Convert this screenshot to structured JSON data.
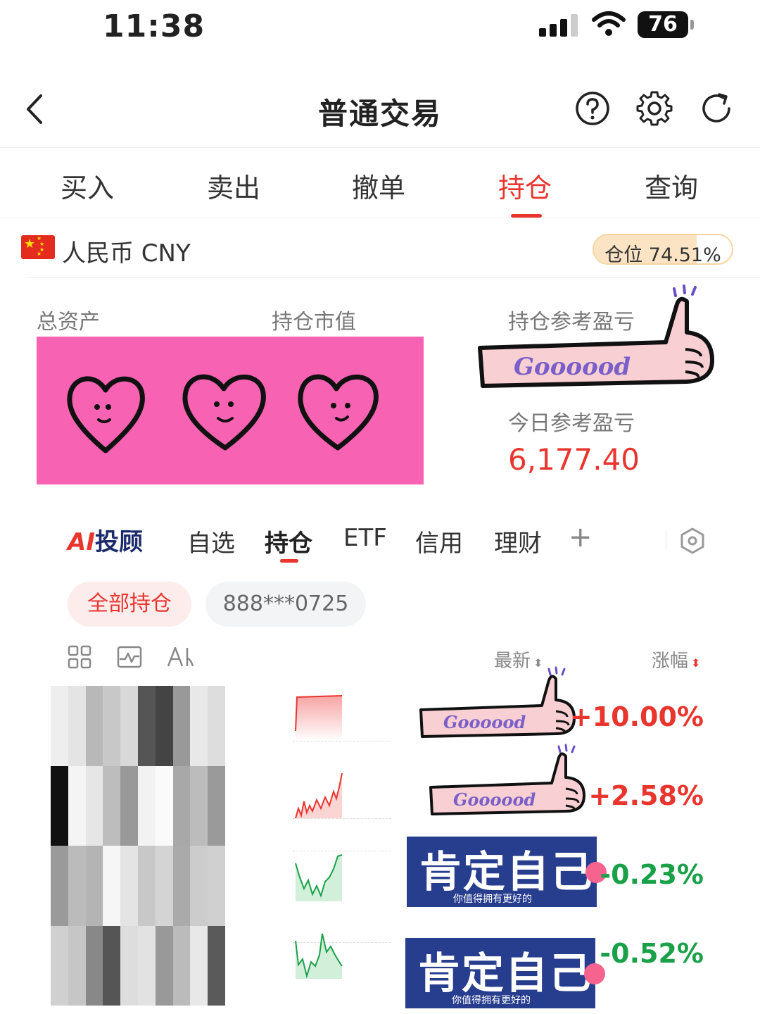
{
  "status": {
    "time": "11:38",
    "battery": "76"
  },
  "header": {
    "title": "普通交易",
    "icons": [
      "back-chevron-icon",
      "help-icon",
      "settings-gear-icon",
      "refresh-icon"
    ]
  },
  "tabs": [
    {
      "label": "买入",
      "active": false
    },
    {
      "label": "卖出",
      "active": false
    },
    {
      "label": "撤单",
      "active": false
    },
    {
      "label": "持仓",
      "active": true
    },
    {
      "label": "查询",
      "active": false
    }
  ],
  "currency": {
    "label": "人民币 CNY",
    "position_label": "仓位 74.51%",
    "position_fraction": 0.7451
  },
  "assets": {
    "total_label": "总资产",
    "market_value_label": "持仓市值",
    "holding_pl_label": "持仓参考盈亏",
    "today_pl_label": "今日参考盈亏",
    "today_pl_value": "6,177.40"
  },
  "sticker": {
    "arm_text": "Goooood",
    "blue_big": "肯定自己",
    "blue_small": "你值得拥有更好的"
  },
  "tabs2": {
    "ai_prefix": "AI",
    "ai_label": "投顾",
    "items": [
      {
        "label": "自选",
        "active": false
      },
      {
        "label": "持仓",
        "active": true
      },
      {
        "label": "ETF",
        "active": false
      },
      {
        "label": "信用",
        "active": false
      },
      {
        "label": "理财",
        "active": false
      }
    ],
    "plus": "+"
  },
  "filters": {
    "all": "全部持仓",
    "account": "888***0725"
  },
  "list_header": {
    "latest": "最新",
    "change": "涨幅",
    "icons": [
      "grid-view-icon",
      "chart-view-icon",
      "ai-icon"
    ]
  },
  "holdings": [
    {
      "change": "+10.00%",
      "direction": "up"
    },
    {
      "change": "+2.58%",
      "direction": "up"
    },
    {
      "change": "-0.23%",
      "direction": "down"
    },
    {
      "change": "-0.52%",
      "direction": "down"
    }
  ],
  "colors": {
    "accent_red": "#e8362f",
    "green": "#1aa049",
    "pink": "#f763b2",
    "sticker_blue": "#273d8e"
  }
}
